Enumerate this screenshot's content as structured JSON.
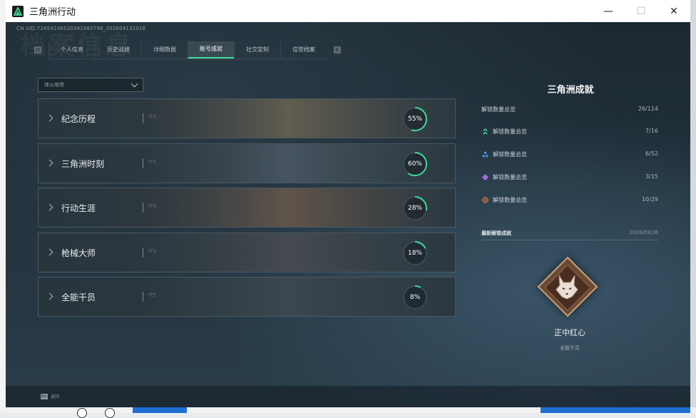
{
  "window": {
    "title": "三角洲行动",
    "controls": {
      "minimize": "—",
      "maximize": "☐",
      "close": "✕"
    }
  },
  "header": {
    "uid": "CN UID:7265410652039168279​8_202604132016",
    "watermark": "档案信息"
  },
  "tabs": {
    "left_key": "Q",
    "right_key": "E",
    "items": [
      {
        "label": "个人信息",
        "active": false
      },
      {
        "label": "历史战绩",
        "active": false
      },
      {
        "label": "详细数据",
        "active": false
      },
      {
        "label": "账号成就",
        "active": true
      },
      {
        "label": "社交定制",
        "active": false
      },
      {
        "label": "信誉档案",
        "active": false
      }
    ]
  },
  "filter": {
    "label": "烽火地带"
  },
  "categories": [
    {
      "name": "纪念历程",
      "ghost": "ITS",
      "progress": 55,
      "label": "55%",
      "bg": "#6b6452"
    },
    {
      "name": "三角洲时刻",
      "ghost": "ITS",
      "progress": 60,
      "label": "60%",
      "bg": "#4c5a66"
    },
    {
      "name": "行动生涯",
      "ghost": "ITS",
      "progress": 28,
      "label": "28%",
      "bg": "#6a5a4c"
    },
    {
      "name": "枪械大师",
      "ghost": "ITS",
      "progress": 18,
      "label": "18%",
      "bg": "#4a4e52"
    },
    {
      "name": "全能干员",
      "ghost": "ITS",
      "progress": 8,
      "label": "8%",
      "bg": "#3f4a52"
    }
  ],
  "summary": {
    "title": "三角洲成就",
    "total": {
      "label": "解锁数量总览",
      "value": "26/114"
    },
    "rows": [
      {
        "label": "解锁数量总览",
        "value": "7/16",
        "icon": "green-chevron-icon",
        "color": "#3ddc97"
      },
      {
        "label": "解锁数量总览",
        "value": "6/52",
        "icon": "blue-diamond-icon",
        "color": "#4a90e2"
      },
      {
        "label": "解锁数量总览",
        "value": "3/15",
        "icon": "purple-diamond-icon",
        "color": "#a56ee0"
      },
      {
        "label": "解锁数量总览",
        "value": "10/29",
        "icon": "orange-diamond-icon",
        "color": "#e07b3a"
      }
    ],
    "latest": {
      "label": "最新解锁成就",
      "date": "2026/03/26"
    },
    "achievement": {
      "name": "正中红心",
      "category": "全能干员"
    }
  },
  "footer": {
    "esc_key": "Esc",
    "esc_label": "返回"
  }
}
